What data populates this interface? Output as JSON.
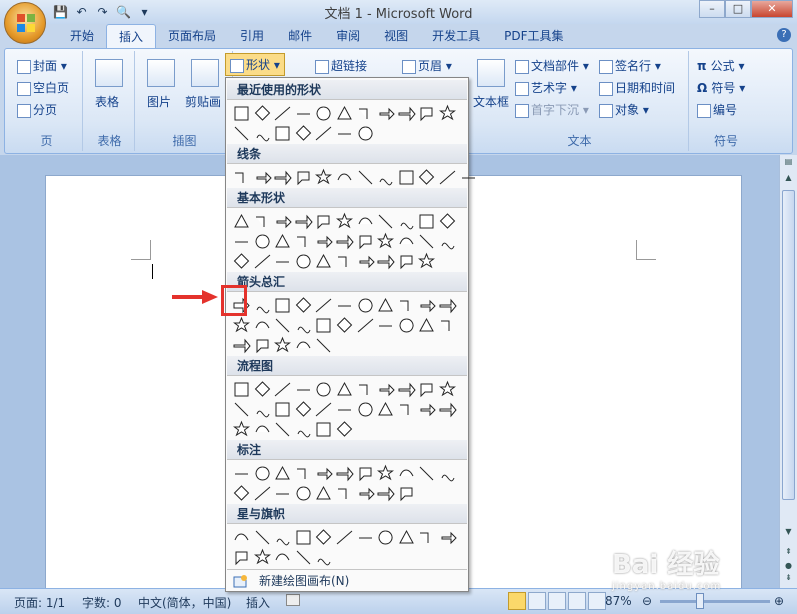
{
  "app": {
    "window_title": "文档 1 - Microsoft Word",
    "qat_icons": [
      "save-icon",
      "undo-icon",
      "redo-icon",
      "print-preview-icon",
      "customize-icon"
    ],
    "window_buttons": {
      "minimize": "–",
      "maximize": "□",
      "close": "✕"
    },
    "help": "?"
  },
  "tabs": [
    {
      "label": "开始",
      "active": false
    },
    {
      "label": "插入",
      "active": true
    },
    {
      "label": "页面布局",
      "active": false
    },
    {
      "label": "引用",
      "active": false
    },
    {
      "label": "邮件",
      "active": false
    },
    {
      "label": "审阅",
      "active": false
    },
    {
      "label": "视图",
      "active": false
    },
    {
      "label": "开发工具",
      "active": false
    },
    {
      "label": "PDF工具集",
      "active": false
    }
  ],
  "ribbon": {
    "pages": {
      "label": "页",
      "items": [
        "封面 ▾",
        "空白页",
        "分页"
      ]
    },
    "tables": {
      "label": "表格",
      "item": "表格"
    },
    "illustrations": {
      "label": "插图",
      "picture": "图片",
      "clipart": "剪贴画",
      "shapes": "形状 ▾"
    },
    "links": {
      "hyperlink": "超链接"
    },
    "header_footer": {
      "header": "页眉 ▾"
    },
    "text": {
      "label": "文本",
      "textbox": "文本框",
      "quickparts": "文档部件 ▾",
      "wordart": "艺术字 ▾",
      "dropcap": "首字下沉 ▾",
      "signature": "签名行 ▾",
      "datetime": "日期和时间",
      "object": "对象 ▾"
    },
    "symbols": {
      "label": "符号",
      "equation": "公式 ▾",
      "symbol": "符号 ▾",
      "number": "编号"
    }
  },
  "shapes_menu": {
    "sections": [
      {
        "title": "最近使用的形状",
        "count": 18
      },
      {
        "title": "线条",
        "count": 12
      },
      {
        "title": "基本形状",
        "count": 32
      },
      {
        "title": "箭头总汇",
        "count": 27
      },
      {
        "title": "流程图",
        "count": 28
      },
      {
        "title": "标注",
        "count": 20
      },
      {
        "title": "星与旗帜",
        "count": 16
      }
    ],
    "new_canvas": "新建绘图画布(N)"
  },
  "status": {
    "page": "页面: 1/1",
    "words": "字数: 0",
    "language": "中文(简体，中国)",
    "mode": "插入",
    "zoom": "87%",
    "zoom_minus": "⊖",
    "zoom_plus": "⊕"
  },
  "watermark": {
    "text": "Bai 经验",
    "sub": "jingyan.baidu.com"
  },
  "colors": {
    "accent": "#15428b",
    "ribbon": "#dbe7f6",
    "highlight": "#e4322c"
  }
}
